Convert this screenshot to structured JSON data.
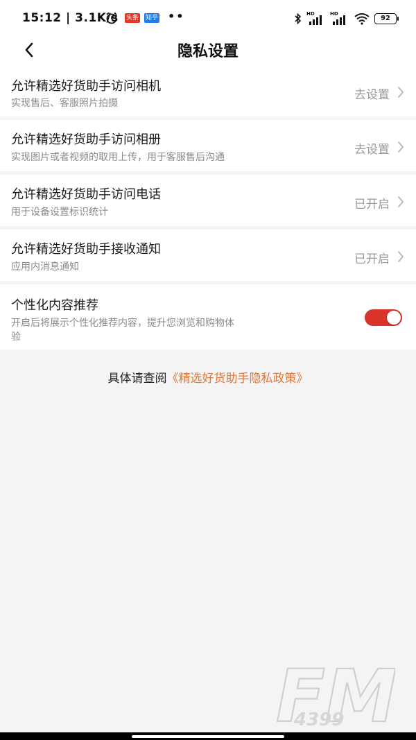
{
  "status_bar": {
    "time": "15:12 | 3.1K/s",
    "badge_1": "头条",
    "badge_2": "知乎",
    "dots": "••",
    "battery": "92"
  },
  "header": {
    "title": "隐私设置"
  },
  "rows": [
    {
      "title": "允许精选好货助手访问相机",
      "subtitle": "实现售后、客服照片拍摄",
      "action": "去设置"
    },
    {
      "title": "允许精选好货助手访问相册",
      "subtitle": "实现图片或者视频的取用上传，用于客服售后沟通",
      "action": "去设置"
    },
    {
      "title": "允许精选好货助手访问电话",
      "subtitle": "用于设备设置标识统计",
      "action": "已开启"
    },
    {
      "title": "允许精选好货助手接收通知",
      "subtitle": "应用内消息通知",
      "action": "已开启"
    }
  ],
  "personalization": {
    "title": "个性化内容推荐",
    "subtitle_line1": "开启后将展示个性化推荐内容，提升您浏览和购物体",
    "subtitle_line2": "验",
    "enabled": true
  },
  "policy": {
    "prefix": "具体请查阅",
    "link": "《精选好货助手隐私政策》"
  },
  "watermark": {
    "brand": "FM",
    "number": "4399"
  },
  "colors": {
    "accent": "#e0783a",
    "toggle_on": "#d9342b"
  }
}
